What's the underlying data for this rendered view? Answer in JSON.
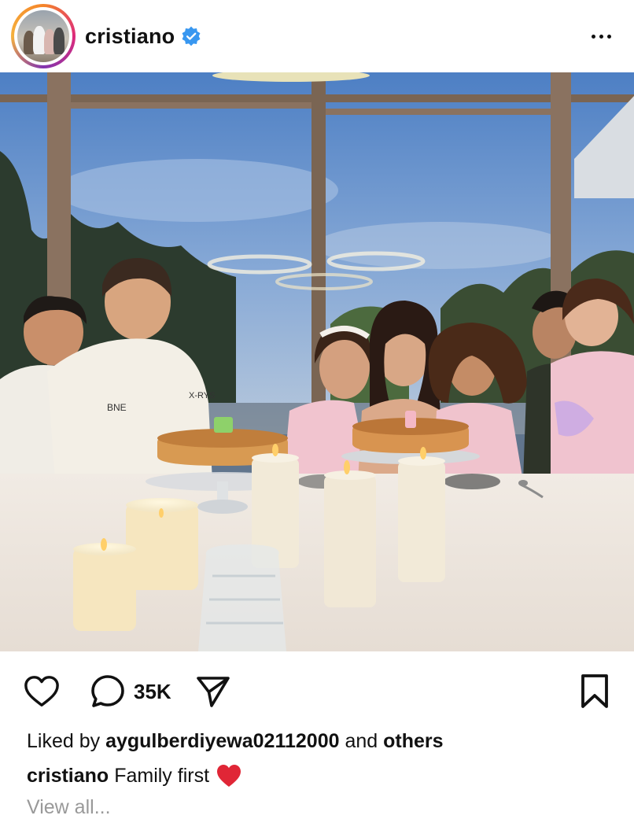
{
  "post": {
    "username": "cristiano",
    "verified": true,
    "comment_count": "35K",
    "liked_by_prefix": "Liked by",
    "liked_by_user": "aygulberdiyewa02112000",
    "liked_by_suffix": "and",
    "liked_by_others": "others",
    "caption_user": "cristiano",
    "caption_text": "Family first",
    "caption_emoji": "red-heart",
    "truncated_line": "View all..."
  },
  "icons": {
    "more": "more-horizontal-icon",
    "like": "heart-outline-icon",
    "comment": "speech-bubble-icon",
    "share": "paper-plane-icon",
    "save": "bookmark-icon",
    "verified": "verified-badge-icon"
  },
  "colors": {
    "verified_blue": "#3897f0",
    "heart_red": "#e02636",
    "text": "#111111"
  }
}
